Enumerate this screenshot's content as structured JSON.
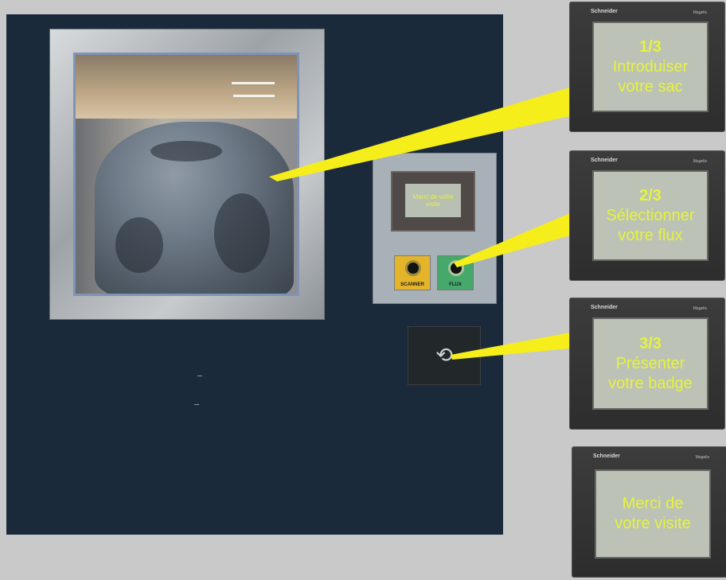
{
  "machine": {
    "control_box": {
      "small_screen_text": "Merci de votre visite",
      "buttons": [
        {
          "label": "SCANNER",
          "color": "#e4b52a"
        },
        {
          "label": "FLUX",
          "color": "#46a86a"
        }
      ]
    }
  },
  "screens": [
    {
      "step": "1/3",
      "line1": "Introduiser",
      "line2": "votre sac",
      "brand": "Schneider",
      "model": "Magelis"
    },
    {
      "step": "2/3",
      "line1": "Sélectionner",
      "line2": "votre flux",
      "brand": "Schneider",
      "model": "Magelis"
    },
    {
      "step": "3/3",
      "line1": "Présenter",
      "line2": "votre badge",
      "brand": "Schneider",
      "model": "Magelis"
    },
    {
      "step": "",
      "line1": "Merci de",
      "line2": "votre visite",
      "brand": "Schneider",
      "model": "Magelis"
    }
  ],
  "colors": {
    "panel": "#1b2a3b",
    "background": "#c9c9c9",
    "callout": "#f6ee1a",
    "screen_text": "#e6f43b"
  },
  "icons": [
    "badge-icon"
  ]
}
